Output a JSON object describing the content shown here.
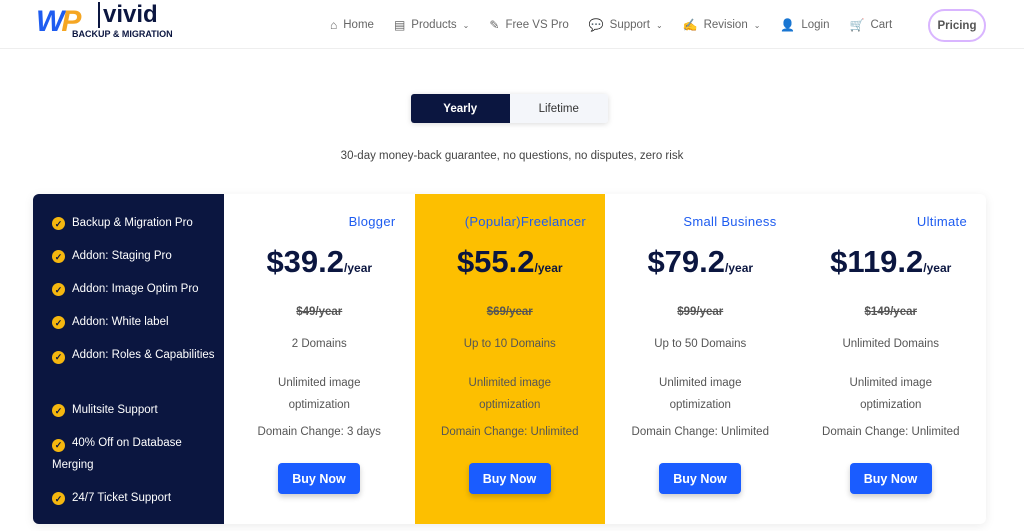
{
  "logo": {
    "mark": "WP",
    "name": "vivid",
    "tagline": "BACKUP & MIGRATION"
  },
  "nav": [
    {
      "label": "Home",
      "icon": "home-icon",
      "glyph": "⌂"
    },
    {
      "label": "Products",
      "icon": "list-icon",
      "glyph": "▤",
      "dropdown": true
    },
    {
      "label": "Free VS Pro",
      "icon": "pin-icon",
      "glyph": "✎"
    },
    {
      "label": "Support",
      "icon": "chat-icon",
      "glyph": "💬",
      "dropdown": true
    },
    {
      "label": "Revision",
      "icon": "edit-icon",
      "glyph": "✍",
      "dropdown": true
    },
    {
      "label": "Login",
      "icon": "user-icon",
      "glyph": "👤"
    },
    {
      "label": "Cart",
      "icon": "cart-icon",
      "glyph": "🛒"
    }
  ],
  "pricing_button": "Pricing",
  "toggle": {
    "yearly": "Yearly",
    "lifetime": "Lifetime",
    "selected": "Yearly"
  },
  "guarantee": "30-day money-back guarantee, no questions, no disputes, zero risk",
  "features": [
    "Backup & Migration Pro",
    "Addon: Staging Pro",
    "Addon: Image Optim Pro",
    "Addon: White label",
    "Addon: Roles & Capabilities",
    "Mulitsite Support",
    "40% Off on Database Merging",
    "24/7 Ticket Support"
  ],
  "plans": [
    {
      "name": "Blogger",
      "price": "$39.2",
      "period": "/year",
      "old": "$49/year",
      "domains": "2 Domains",
      "image": "Unlimited image optimization",
      "change": "Domain Change: 3 days",
      "buy": "Buy Now"
    },
    {
      "name": "(Popular)Freelancer",
      "price": "$55.2",
      "period": "/year",
      "old": "$69/year",
      "domains": "Up to 10 Domains",
      "image": "Unlimited image optimization",
      "change": "Domain Change: Unlimited",
      "buy": "Buy Now"
    },
    {
      "name": "Small Business",
      "price": "$79.2",
      "period": "/year",
      "old": "$99/year",
      "domains": "Up to 50 Domains",
      "image": "Unlimited image optimization",
      "change": "Domain Change: Unlimited",
      "buy": "Buy Now"
    },
    {
      "name": "Ultimate",
      "price": "$119.2",
      "period": "/year",
      "old": "$149/year",
      "domains": "Unlimited Domains",
      "image": "Unlimited image optimization",
      "change": "Domain Change: Unlimited",
      "buy": "Buy Now"
    }
  ],
  "colors": {
    "navy": "#0b1640",
    "accent": "#1a5cff",
    "popular": "#fdbf00"
  }
}
